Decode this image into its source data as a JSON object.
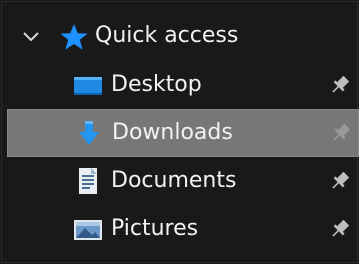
{
  "nav_pane": {
    "quick_access": {
      "label": "Quick access",
      "expanded": true,
      "icon": "star-icon",
      "chevron_icon": "chevron-down-icon"
    },
    "items": [
      {
        "label": "Desktop",
        "icon": "desktop-folder-icon",
        "pinned": true,
        "selected": false
      },
      {
        "label": "Downloads",
        "icon": "downloads-folder-icon",
        "pinned": true,
        "selected": true
      },
      {
        "label": "Documents",
        "icon": "documents-folder-icon",
        "pinned": true,
        "selected": false
      },
      {
        "label": "Pictures",
        "icon": "pictures-folder-icon",
        "pinned": true,
        "selected": false
      }
    ],
    "colors": {
      "background": "#191919",
      "selected_background": "#777777",
      "text": "#f2f2f2",
      "accent": "#1e90ff"
    }
  }
}
